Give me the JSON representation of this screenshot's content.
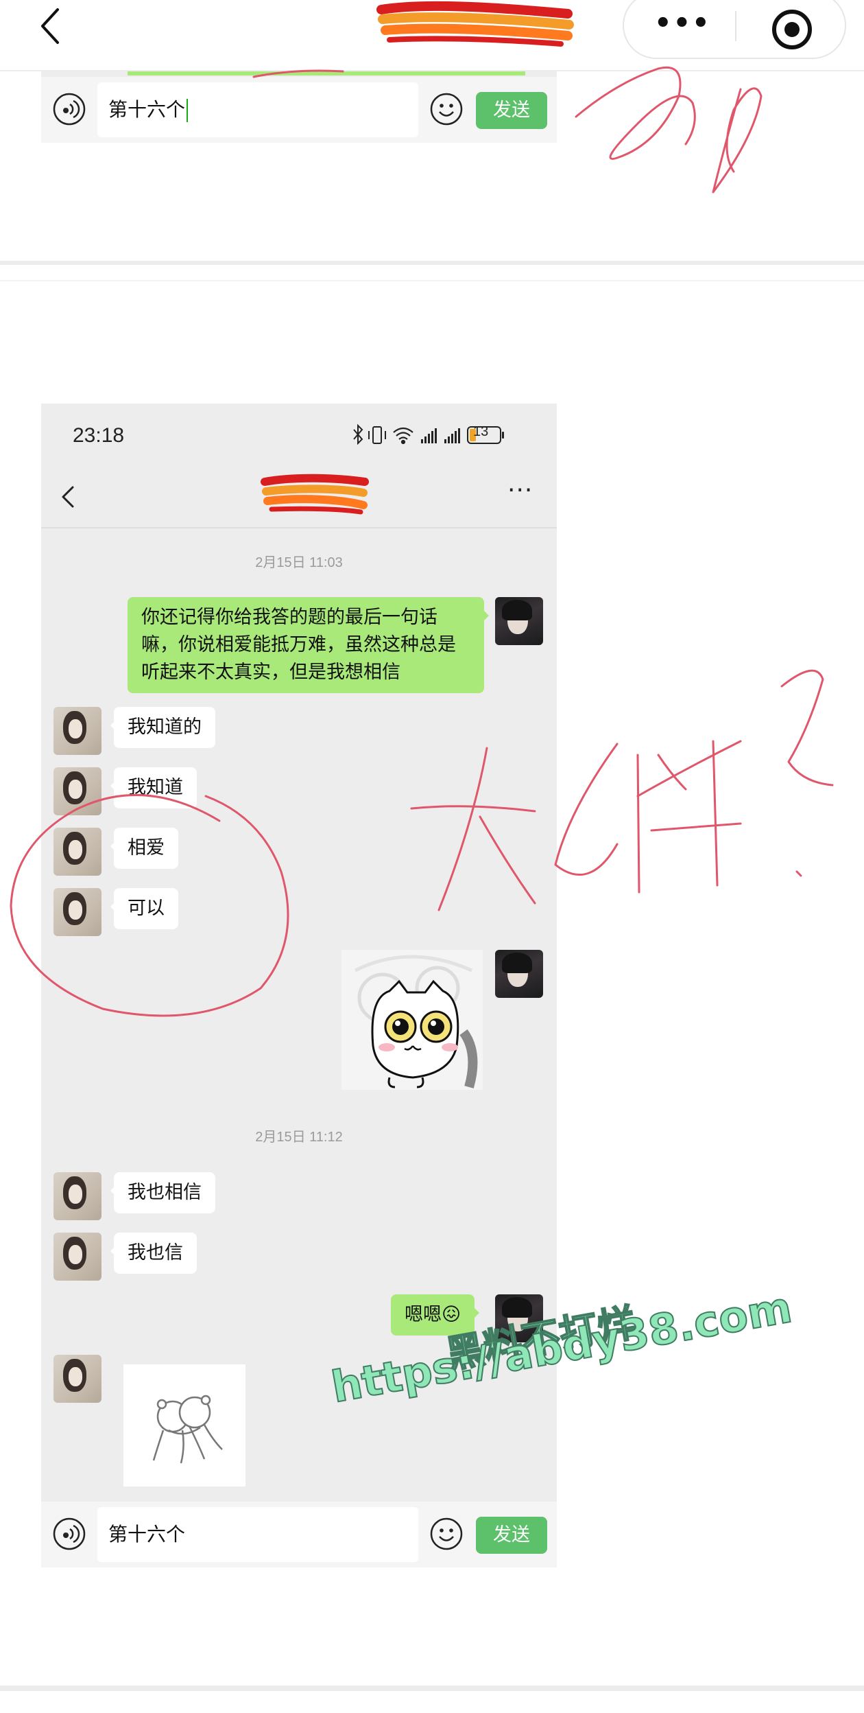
{
  "top_bar": {
    "back_icon": "chevron-left-icon",
    "more_icon": "more-dots-icon",
    "target_icon": "record-target-icon"
  },
  "first_screenshot": {
    "input_value": "第十六个",
    "send_label": "发送"
  },
  "phone": {
    "status_time": "23:18",
    "battery": "13",
    "messages": [
      {
        "type": "timestamp",
        "text": "2月15日 11:03"
      },
      {
        "type": "text",
        "from": "me",
        "text": "你还记得你给我答的题的最后一句话嘛，你说相爱能抵万难，虽然这种总是听起来不太真实，但是我想相信"
      },
      {
        "type": "text",
        "from": "her",
        "text": "我知道的"
      },
      {
        "type": "text",
        "from": "her",
        "text": "我知道"
      },
      {
        "type": "text",
        "from": "her",
        "text": "相爱"
      },
      {
        "type": "text",
        "from": "her",
        "text": "可以"
      },
      {
        "type": "sticker",
        "from": "me",
        "description": "cat-sticker"
      },
      {
        "type": "timestamp",
        "text": "2月15日 11:12"
      },
      {
        "type": "text",
        "from": "her",
        "text": "我也相信"
      },
      {
        "type": "text",
        "from": "her",
        "text": "我也信"
      },
      {
        "type": "text",
        "from": "me",
        "text": "嗯嗯😖"
      },
      {
        "type": "sticker",
        "from": "her",
        "description": "hug-sticker"
      }
    ],
    "input_value": "第十六个",
    "send_label": "发送"
  },
  "watermark": {
    "line1": "黑料不打烊",
    "line2": "https://abdy38.com"
  },
  "colors": {
    "chat_bg": "#ededed",
    "out_bubble": "#a9e97a",
    "send_button": "#5cc16a",
    "annotation_red": "#e0566a",
    "watermark": "#8fe6b6"
  }
}
